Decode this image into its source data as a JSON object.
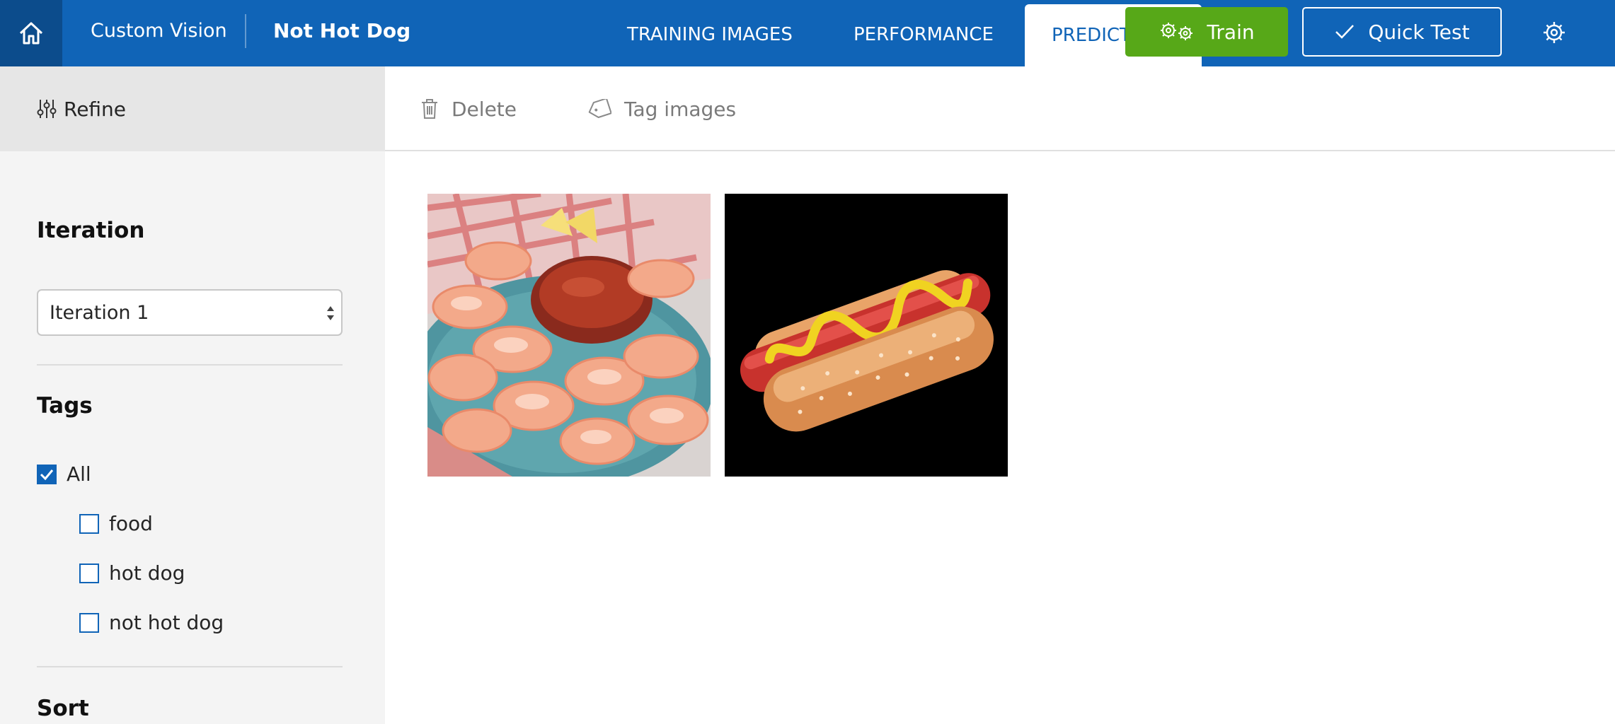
{
  "header": {
    "brand": "Custom Vision",
    "project": "Not Hot Dog",
    "tabs": [
      {
        "label": "TRAINING IMAGES"
      },
      {
        "label": "PERFORMANCE"
      },
      {
        "label": "PREDICTIONS"
      }
    ],
    "active_tab": "PREDICTIONS",
    "train_label": "Train",
    "quick_test_label": "Quick Test"
  },
  "toolbar": {
    "refine_label": "Refine",
    "delete_label": "Delete",
    "tag_images_label": "Tag images"
  },
  "sidebar": {
    "iteration_title": "Iteration",
    "iteration_value": "Iteration 1",
    "tags_title": "Tags",
    "tags": [
      {
        "label": "All",
        "checked": true
      },
      {
        "label": "food",
        "checked": false
      },
      {
        "label": "hot dog",
        "checked": false
      },
      {
        "label": "not hot dog",
        "checked": false
      }
    ],
    "sort_title": "Sort"
  },
  "images": [
    {
      "subject": "shrimp cocktail"
    },
    {
      "subject": "hot dog"
    }
  ],
  "colors": {
    "header_blue": "#1064b7",
    "home_blue": "#0c4c8c",
    "train_green": "#57a818",
    "sidebar_bg": "#f4f4f4"
  },
  "icons": [
    "home-icon",
    "gears-icon",
    "checkmark-icon",
    "gear-icon",
    "sliders-icon",
    "trash-icon",
    "tag-icon",
    "checkbox-check-icon"
  ]
}
